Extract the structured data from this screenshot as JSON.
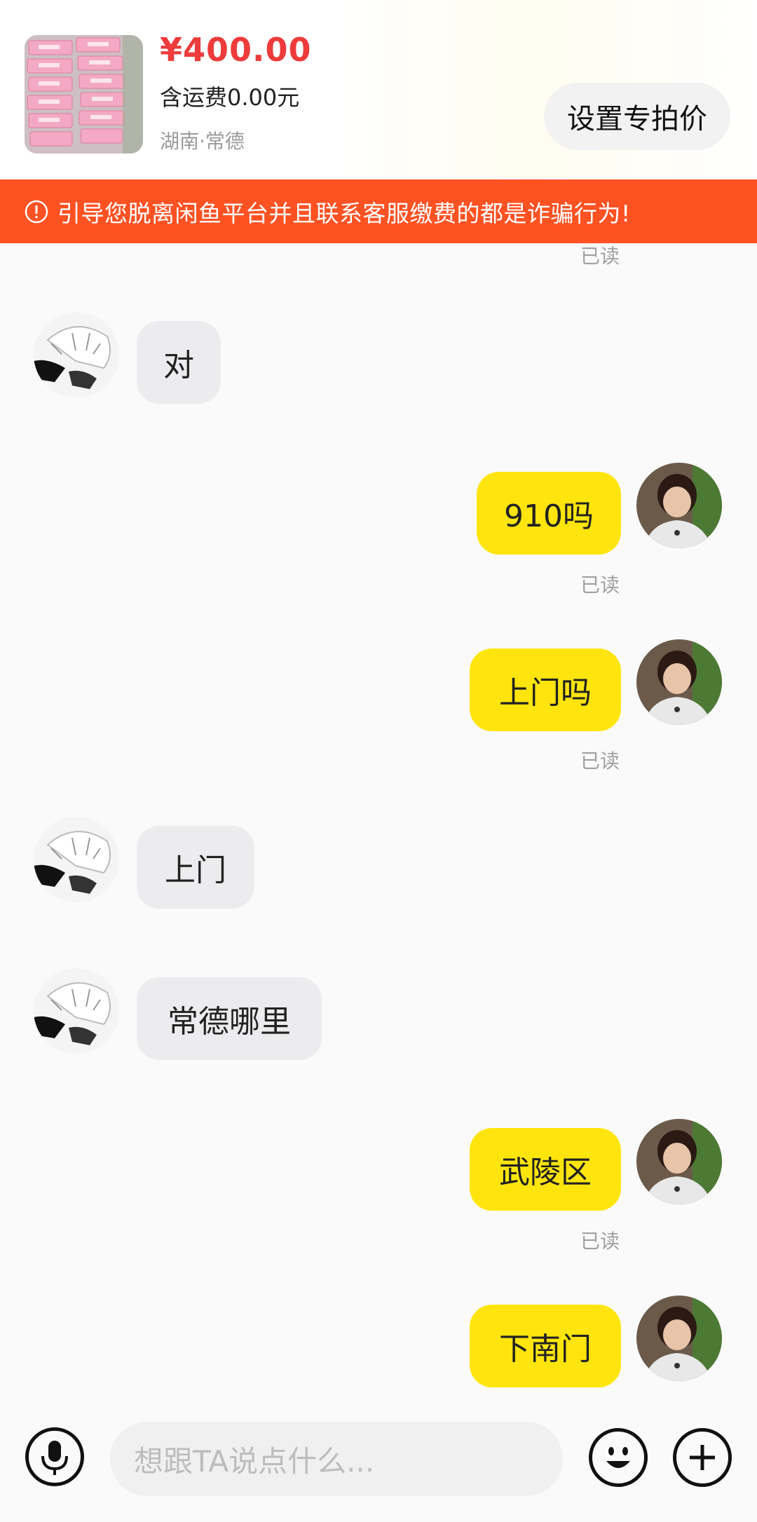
{
  "product": {
    "price": "¥400.00",
    "shipping": "含运费0.00元",
    "location": "湖南·常德",
    "set_price_label": "设置专拍价"
  },
  "warning": {
    "text": "引导您脱离闲鱼平台并且联系客服缴费的都是诈骗行为!"
  },
  "messages": [
    {
      "side": "read-status",
      "text": "已读"
    },
    {
      "side": "left",
      "text": "对"
    },
    {
      "side": "right",
      "text": "910吗",
      "status": "已读"
    },
    {
      "side": "right",
      "text": "上门吗",
      "status": "已读"
    },
    {
      "side": "left",
      "text": "上门"
    },
    {
      "side": "left",
      "text": "常德哪里"
    },
    {
      "side": "right",
      "text": "武陵区",
      "status": "已读"
    },
    {
      "side": "right",
      "text": "下南门"
    }
  ],
  "input": {
    "placeholder": "想跟TA说点什么..."
  },
  "icons": {
    "voice": "microphone-icon",
    "emoji": "smiley-icon",
    "more": "plus-icon",
    "warning": "alert-circle-icon"
  },
  "colors": {
    "price": "#ee3b3b",
    "warning_bg": "#ff5223",
    "sent_bubble": "#ffe50d",
    "received_bubble": "#ececef"
  }
}
